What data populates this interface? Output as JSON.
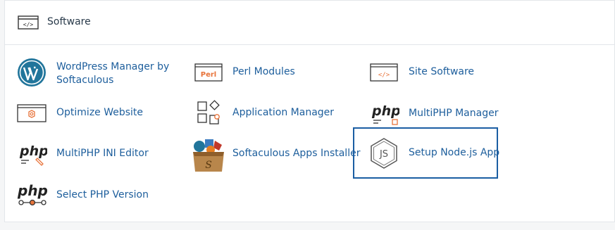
{
  "section": {
    "title": "Software",
    "icon": "code-window-icon"
  },
  "items": [
    {
      "label": "WordPress Manager by Softaculous",
      "label_line1": "WordPress Manager by",
      "label_line2": "Softaculous",
      "icon": "wordpress-icon"
    },
    {
      "label": "Perl Modules",
      "icon": "perl-icon",
      "icon_text": "Perl"
    },
    {
      "label": "Site Software",
      "icon": "code-window-icon"
    },
    {
      "label": "Optimize Website",
      "icon": "optimize-gear-icon"
    },
    {
      "label": "Application Manager",
      "icon": "application-manager-icon"
    },
    {
      "label": "MultiPHP Manager",
      "icon": "php-manager-icon",
      "icon_text": "php"
    },
    {
      "label": "MultiPHP INI Editor",
      "icon": "php-ini-editor-icon",
      "icon_text": "php"
    },
    {
      "label": "Softaculous Apps Installer",
      "icon": "softaculous-icon"
    },
    {
      "label": "Setup Node.js App",
      "icon": "nodejs-icon",
      "highlighted": true
    },
    {
      "label": "Select PHP Version",
      "icon": "php-version-icon",
      "icon_text": "php"
    }
  ],
  "colors": {
    "link": "#1d5e9c",
    "accent_orange": "#e8743b",
    "highlight_border": "#1b5ea3"
  }
}
